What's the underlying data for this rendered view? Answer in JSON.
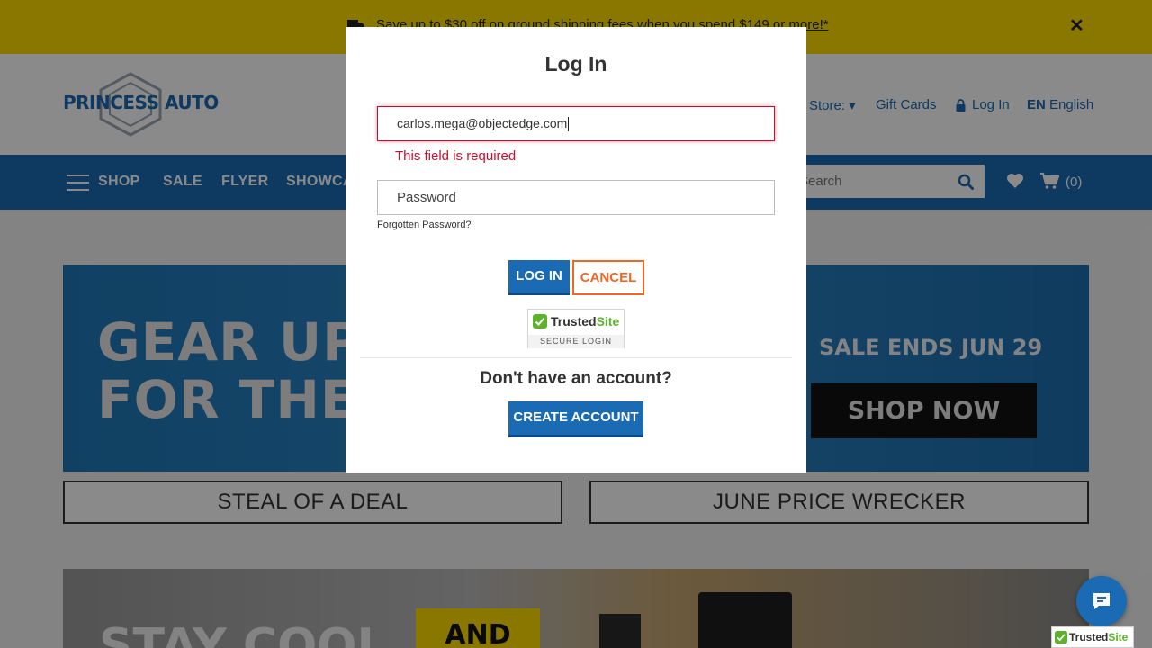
{
  "promo": {
    "text": "Save up to $30 off on ground shipping fees when you spend $149 or more!*",
    "close": "✕"
  },
  "header": {
    "logo_text": "PRINCESS AUTO",
    "store_label": "Store: ▾",
    "gift_cards": "Gift Cards",
    "login": "Log In",
    "lang_code": "EN",
    "lang_name": "English"
  },
  "nav": {
    "shop": "SHOP",
    "sale": "SALE",
    "flyer": "FLYER",
    "showcase": "SHOWCASE",
    "search_placeholder": "Search",
    "cart_count": "(0)"
  },
  "hero": {
    "line1": "GEAR UP",
    "line2": "FOR THE",
    "sale_ends": "SALE ENDS JUN 29",
    "shop_now": "SHOP NOW"
  },
  "deals": {
    "steal": "STEAL OF A DEAL",
    "wrecker": "JUNE PRICE WRECKER"
  },
  "banner2": {
    "text": "STAY COOL",
    "and": "AND"
  },
  "modal": {
    "title": "Log In",
    "email_value": "carlos.mega@objectedge.com",
    "email_error": "This field is required",
    "password_placeholder": "Password",
    "forgot": "Forgotten Password?",
    "login_button": "LOG IN",
    "cancel_button": "CANCEL",
    "trusted_name": "Trusted",
    "trusted_site": "Site",
    "trusted_sub": "SECURE LOGIN",
    "no_account": "Don't have an account?",
    "create_button": "CREATE ACCOUNT"
  },
  "corner": {
    "trusted_name": "Trusted",
    "trusted_site": "Site"
  },
  "colors": {
    "brand_blue": "#1a6ab4",
    "promo_yellow": "#fedd00",
    "error_red": "#c8102e",
    "cancel_orange": "#f26522",
    "trusted_green": "#5cb32b"
  },
  "icons": [
    "truck-icon",
    "close-icon",
    "lock-icon",
    "hamburger-icon",
    "search-icon",
    "heart-icon",
    "cart-icon",
    "check-icon",
    "chat-icon"
  ]
}
